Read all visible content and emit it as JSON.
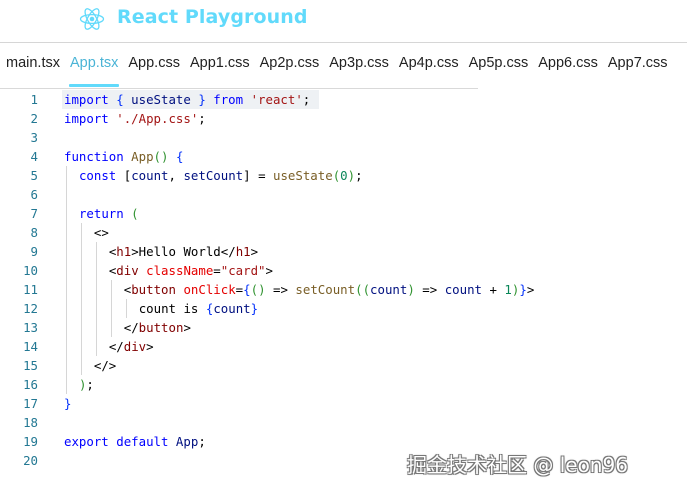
{
  "app": {
    "title": "React Playground",
    "accent": "#61dafb"
  },
  "logo": {
    "icon": "react-atom-icon"
  },
  "tabs": [
    {
      "label": "main.tsx",
      "active": false
    },
    {
      "label": "App.tsx",
      "active": true
    },
    {
      "label": "App.css",
      "active": false
    },
    {
      "label": "App1.css",
      "active": false
    },
    {
      "label": "Ap2p.css",
      "active": false
    },
    {
      "label": "Ap3p.css",
      "active": false
    },
    {
      "label": "Ap4p.css",
      "active": false
    },
    {
      "label": "Ap5p.css",
      "active": false
    },
    {
      "label": "App6.css",
      "active": false
    },
    {
      "label": "App7.css",
      "active": false
    }
  ],
  "editor": {
    "file": "App.tsx",
    "lines": [
      "import { useState } from 'react';",
      "import './App.css';",
      "",
      "function App() {",
      "  const [count, setCount] = useState(0);",
      "",
      "  return (",
      "    <>",
      "      <h1>Hello World</h1>",
      "      <div className=\"card\">",
      "        <button onClick={() => setCount((count) => count + 1)}>",
      "          count is {count}",
      "        </button>",
      "      </div>",
      "    </>",
      "  );",
      "}",
      "",
      "export default App;",
      ""
    ],
    "line_numbers": [
      "1",
      "2",
      "3",
      "4",
      "5",
      "6",
      "7",
      "8",
      "9",
      "10",
      "11",
      "12",
      "13",
      "14",
      "15",
      "16",
      "17",
      "18",
      "19",
      "20"
    ]
  },
  "watermark": "掘金技术社区 @ leon96"
}
